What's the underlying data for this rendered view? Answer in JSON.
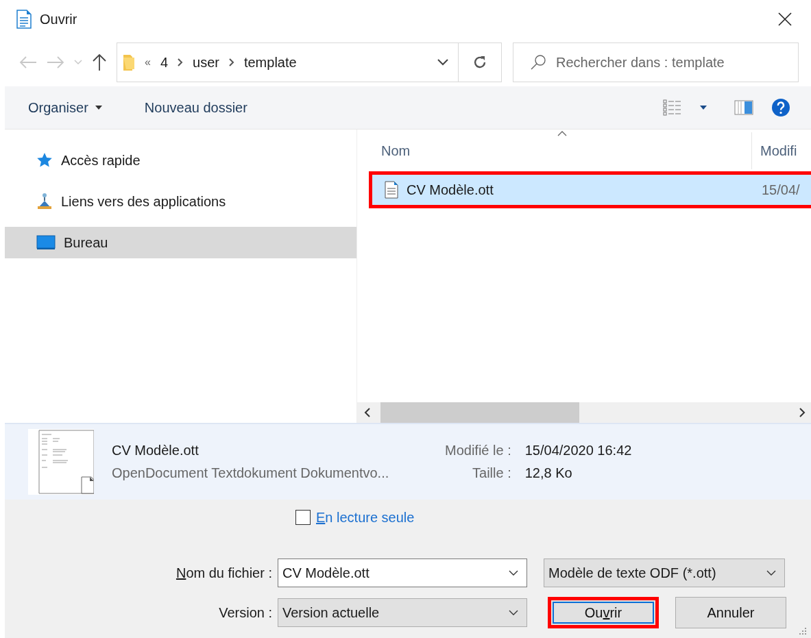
{
  "window": {
    "title": "Ouvrir"
  },
  "nav": {
    "overflow": "«",
    "back_disabled": true,
    "forward_disabled": true,
    "breadcrumb": [
      "4",
      "user",
      "template"
    ],
    "search": {
      "placeholder": "Rechercher dans : template"
    }
  },
  "toolbar": {
    "organize": "Organiser",
    "new_folder": "Nouveau dossier"
  },
  "sidebar": {
    "items": [
      {
        "kind": "star",
        "label": "Accès rapide",
        "selected": false
      },
      {
        "kind": "apps",
        "label": "Liens vers des applications",
        "selected": false
      },
      {
        "kind": "desktop",
        "label": "Bureau",
        "selected": true
      }
    ]
  },
  "file_list": {
    "columns": [
      "Nom",
      "Modifi"
    ],
    "rows": [
      {
        "name": "CV Modèle.ott",
        "modified": "15/04/",
        "selected": true,
        "highlighted": true
      }
    ]
  },
  "details": {
    "name": "CV Modèle.ott",
    "type": "OpenDocument Textdokument Dokumentvo...",
    "fields": [
      {
        "label": "Modifié le :",
        "value": "15/04/2020 16:42"
      },
      {
        "label": "Taille :",
        "value": "12,8 Ko"
      }
    ]
  },
  "read_only": {
    "label": {
      "key": "E",
      "post": "n lecture seule"
    },
    "checked": false
  },
  "file_name": {
    "label": {
      "key": "N",
      "post": "om du fichier :"
    },
    "value": "CV Modèle.ott"
  },
  "file_type": {
    "value": "Modèle de texte ODF (*.ott)"
  },
  "version": {
    "label": "Version :",
    "value": "Version actuelle"
  },
  "buttons": [
    {
      "kind": "primary",
      "label": {
        "pre": "Ou",
        "key": "v",
        "post": "rir"
      },
      "highlighted": true
    },
    {
      "kind": "cancel",
      "label": {
        "pre": "Annuler"
      },
      "highlighted": false
    }
  ]
}
